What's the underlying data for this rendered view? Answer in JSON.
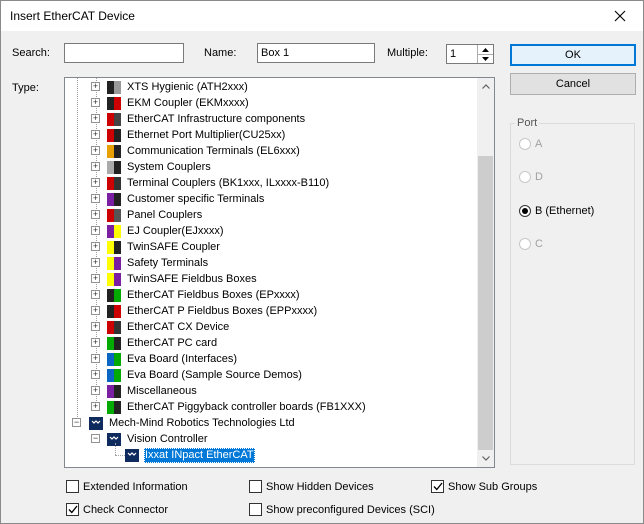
{
  "window": {
    "title": "Insert EtherCAT Device"
  },
  "form": {
    "search_label": "Search:",
    "search_value": "",
    "name_label": "Name:",
    "name_value": "Box 1",
    "multiple_label": "Multiple:",
    "multiple_value": "1",
    "type_label": "Type:"
  },
  "buttons": {
    "ok": "OK",
    "cancel": "Cancel"
  },
  "tree": {
    "items": [
      {
        "label": "XTS Hygienic (ATH2xxx)",
        "icon": "xts-icon",
        "level": 1
      },
      {
        "label": "EKM Coupler (EKMxxxx)",
        "icon": "ekm-coupler-icon",
        "level": 1
      },
      {
        "label": "EtherCAT Infrastructure components",
        "icon": "infrastructure-icon",
        "level": 1
      },
      {
        "label": "Ethernet Port Multiplier(CU25xx)",
        "icon": "port-multiplier-icon",
        "level": 1
      },
      {
        "label": "Communication Terminals (EL6xxx)",
        "icon": "communication-terminal-icon",
        "level": 1
      },
      {
        "label": "System Couplers",
        "icon": "system-coupler-icon",
        "level": 1
      },
      {
        "label": "Terminal Couplers (BK1xxx, ILxxxx-B110)",
        "icon": "terminal-coupler-icon",
        "level": 1
      },
      {
        "label": "Customer specific Terminals",
        "icon": "customer-terminal-icon",
        "level": 1
      },
      {
        "label": "Panel Couplers",
        "icon": "panel-coupler-icon",
        "level": 1
      },
      {
        "label": "EJ Coupler(EJxxxx)",
        "icon": "ej-coupler-icon",
        "level": 1
      },
      {
        "label": "TwinSAFE Coupler",
        "icon": "twinsafe-coupler-icon",
        "level": 1
      },
      {
        "label": "Safety Terminals",
        "icon": "safety-terminal-icon",
        "level": 1
      },
      {
        "label": "TwinSAFE Fieldbus Boxes",
        "icon": "twinsafe-fieldbus-icon",
        "level": 1
      },
      {
        "label": "EtherCAT Fieldbus Boxes (EPxxxx)",
        "icon": "fieldbus-box-icon",
        "level": 1
      },
      {
        "label": "EtherCAT P Fieldbus Boxes (EPPxxxx)",
        "icon": "p-fieldbus-box-icon",
        "level": 1
      },
      {
        "label": "EtherCAT CX Device",
        "icon": "cx-device-icon",
        "level": 1
      },
      {
        "label": "EtherCAT PC card",
        "icon": "pc-card-icon",
        "level": 1
      },
      {
        "label": "Eva Board (Interfaces)",
        "icon": "eva-board-icon",
        "level": 1
      },
      {
        "label": "Eva Board (Sample Source Demos)",
        "icon": "eva-board-icon",
        "level": 1
      },
      {
        "label": "Miscellaneous",
        "icon": "misc-icon",
        "level": 1
      },
      {
        "label": "EtherCAT Piggyback controller boards (FB1XXX)",
        "icon": "piggyback-icon",
        "level": 1
      },
      {
        "label": "Mech-Mind Robotics Technologies Ltd",
        "icon": "vendor-icon",
        "level": 0
      },
      {
        "label": "Vision Controller",
        "icon": "vendor-icon",
        "level": 1
      },
      {
        "label": "Ixxat INpact EtherCAT",
        "icon": "vendor-icon",
        "level": 2,
        "selected": true
      }
    ]
  },
  "port": {
    "title": "Port",
    "options": [
      {
        "label": "A",
        "enabled": false,
        "checked": false
      },
      {
        "label": "D",
        "enabled": false,
        "checked": false
      },
      {
        "label": "B (Ethernet)",
        "enabled": true,
        "checked": true
      },
      {
        "label": "C",
        "enabled": false,
        "checked": false
      }
    ]
  },
  "checkboxes": {
    "extended_info": {
      "label": "Extended Information",
      "checked": false
    },
    "show_hidden": {
      "label": "Show Hidden Devices",
      "checked": false
    },
    "show_sub_groups": {
      "label": "Show Sub Groups",
      "checked": true
    },
    "check_connector": {
      "label": "Check Connector",
      "checked": true
    },
    "show_preconfigured": {
      "label": "Show preconfigured Devices (SCI)",
      "checked": false
    }
  }
}
